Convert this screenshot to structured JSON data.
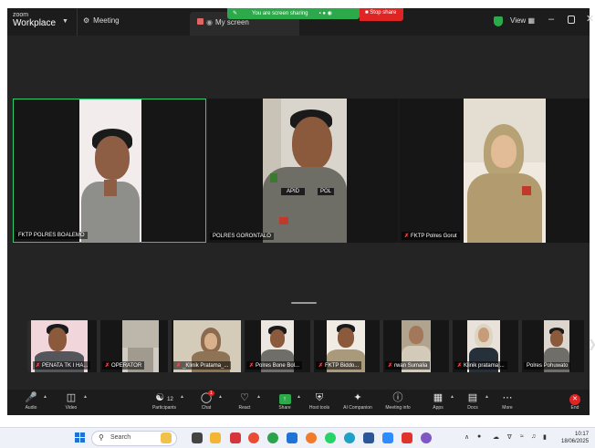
{
  "titlebar": {
    "logo_top": "zoom",
    "logo_bottom": "Workplace",
    "meeting_tab": "Meeting",
    "screen_tab": "My screen",
    "share_status": "You are screen sharing",
    "stop_share": "Stop share",
    "view_label": "View",
    "colors": {
      "share_green": "#2ca94a",
      "stop_red": "#e02424"
    }
  },
  "speakers": [
    {
      "name": "FKTP POLRES BOALEMO",
      "muted": false,
      "active": true
    },
    {
      "name": "POLRES GORONTALO",
      "muted": false,
      "active": false
    },
    {
      "name": "FKTP Polres Gorut",
      "muted": true,
      "active": false
    }
  ],
  "gallery": [
    {
      "name": "PENATA TK I HA...",
      "muted": true
    },
    {
      "name": "OPERATOR",
      "muted": true
    },
    {
      "name": "_Klinik Pratama_...",
      "muted": true
    },
    {
      "name": "Polres Bone Bol...",
      "muted": true
    },
    {
      "name": "FKTP Biddo...",
      "muted": true
    },
    {
      "name": "rwan Sumalia",
      "muted": true
    },
    {
      "name": "Klinik pratama ...",
      "muted": true
    },
    {
      "name": "Polres Pohuwato",
      "muted": false
    }
  ],
  "toolbar": {
    "audio": "Audio",
    "video": "Video",
    "participants": "Participants",
    "participants_count": "12",
    "chat": "Chat",
    "chat_badge": "1",
    "react": "React",
    "share": "Share",
    "host_tools": "Host tools",
    "ai_companion": "AI Companion",
    "meeting_info": "Meeting info",
    "apps": "Apps",
    "docs": "Docs",
    "more": "More",
    "end": "End"
  },
  "taskbar": {
    "search_placeholder": "Search",
    "time": "10:17",
    "date": "18/06/2025"
  }
}
